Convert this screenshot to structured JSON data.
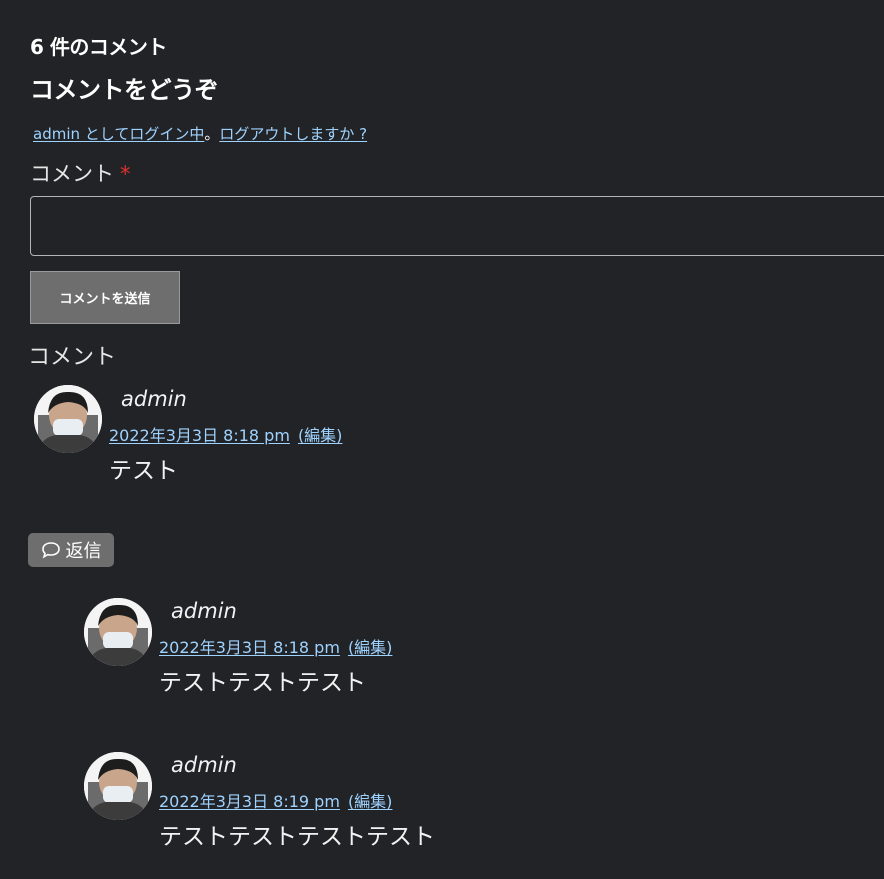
{
  "comments_count_title": "6 件のコメント",
  "reply_title": "コメントをどうぞ",
  "logged_in": {
    "user_link": "admin としてログイン中",
    "separator": "。",
    "logout_link": "ログアウトしますか ?"
  },
  "form": {
    "comment_label": "コメント",
    "required_mark": "*",
    "comment_value": "",
    "submit_label": "コメントを送信"
  },
  "comments_section_title": "コメント",
  "comments": [
    {
      "author": "admin",
      "date": "2022年3月3日 8:18 pm",
      "edit": "(編集)",
      "text": "テスト"
    },
    {
      "author": "admin",
      "date": "2022年3月3日 8:18 pm",
      "edit": "(編集)",
      "text": "テストテストテスト"
    },
    {
      "author": "admin",
      "date": "2022年3月3日 8:19 pm",
      "edit": "(編集)",
      "text": "テストテストテストテスト"
    }
  ],
  "reply_button": {
    "icon": "speech-bubble-icon",
    "label": "返信"
  }
}
